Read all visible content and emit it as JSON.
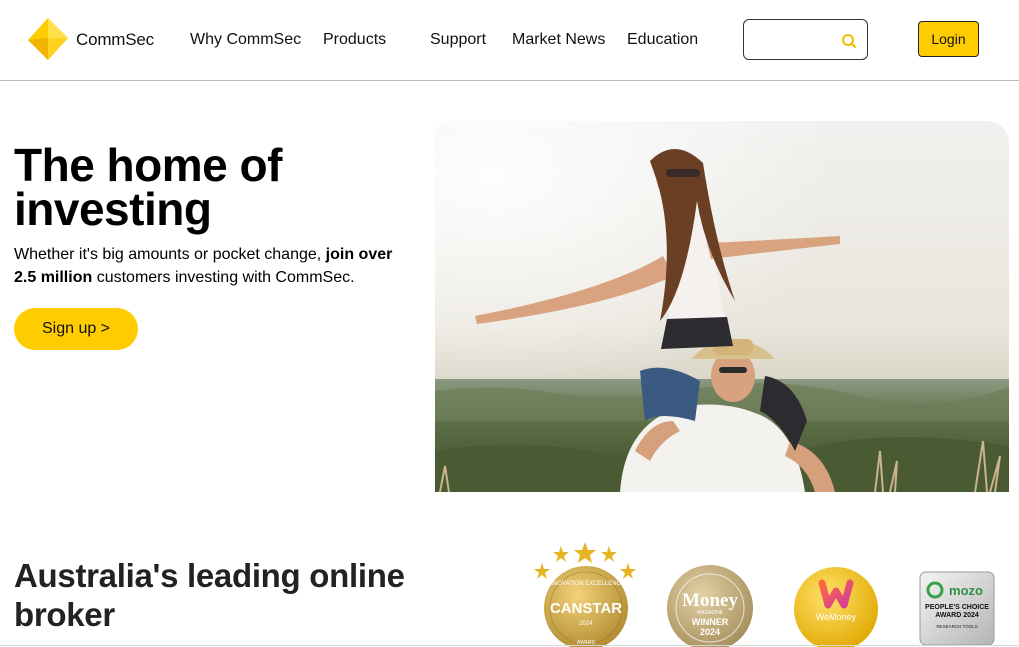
{
  "header": {
    "logo_text": "CommSec",
    "nav": [
      {
        "label": "Why CommSec"
      },
      {
        "label": "Products"
      },
      {
        "label": "Support"
      },
      {
        "label": "Market News"
      },
      {
        "label": "Education"
      }
    ],
    "search": {
      "value": "",
      "placeholder": ""
    },
    "login_label": "Login"
  },
  "hero": {
    "title": "The home of investing",
    "desc_part1": "Whether it's big amounts or pocket change, ",
    "desc_bold": "join over 2.5 million",
    "desc_part2": " customers investing with CommSec.",
    "signup_label": "Sign up >"
  },
  "broker": {
    "title": "Australia's leading online broker"
  },
  "awards": [
    {
      "name": "canstar",
      "arc": "INNOVATION EXCELLENCE",
      "title": "CANSTAR",
      "year": "2024",
      "sub": "AWARD"
    },
    {
      "name": "money-magazine",
      "title": "Money",
      "sub": "MAGAZINE",
      "winner": "WINNER",
      "year": "2024"
    },
    {
      "name": "wemoney",
      "title": "WeMoney"
    },
    {
      "name": "mozo",
      "title": "mozo",
      "line1": "PEOPLE'S CHOICE",
      "line2": "AWARD 2024",
      "line3": "RESEARCH TOOLS"
    }
  ],
  "colors": {
    "brand_yellow": "#ffcc00",
    "text": "#000000",
    "divider": "#b9b9b9"
  }
}
